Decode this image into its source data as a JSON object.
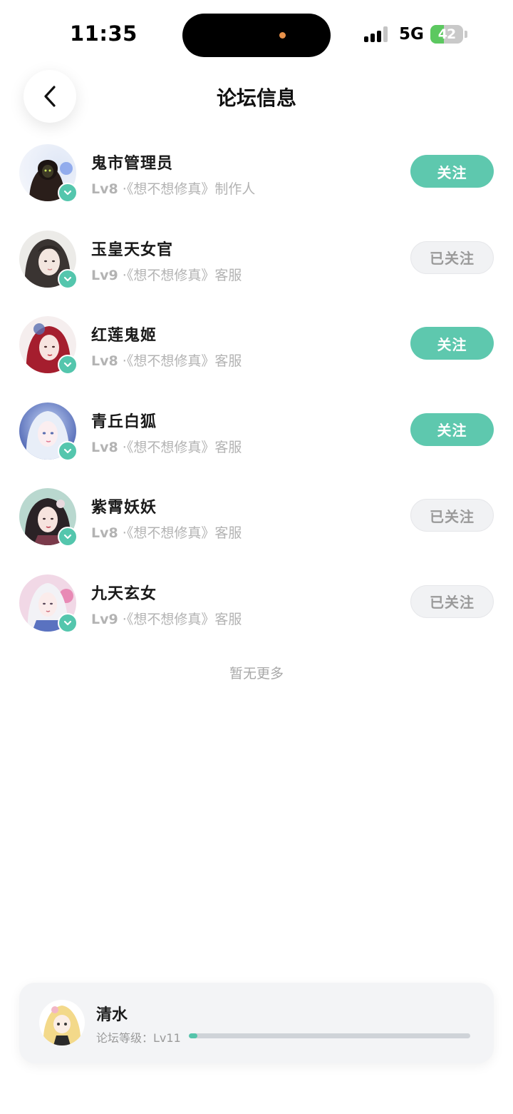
{
  "status_bar": {
    "time": "11:35",
    "network": "5G",
    "battery_level": "42",
    "battery_fraction": 0.42
  },
  "header": {
    "title": "论坛信息",
    "back_icon": "chevron-left-icon"
  },
  "members": [
    {
      "name": "鬼市管理员",
      "level": "Lv8",
      "separator": "·",
      "role": "《想不想修真》制作人",
      "button": "关注",
      "followed": false
    },
    {
      "name": "玉皇天女官",
      "level": "Lv9",
      "separator": "·",
      "role": "《想不想修真》客服",
      "button": "已关注",
      "followed": true
    },
    {
      "name": "红莲鬼姬",
      "level": "Lv8",
      "separator": "·",
      "role": "《想不想修真》客服",
      "button": "关注",
      "followed": false
    },
    {
      "name": "青丘白狐",
      "level": "Lv8",
      "separator": "·",
      "role": "《想不想修真》客服",
      "button": "关注",
      "followed": false
    },
    {
      "name": "紫霄妖妖",
      "level": "Lv8",
      "separator": "·",
      "role": "《想不想修真》客服",
      "button": "已关注",
      "followed": true
    },
    {
      "name": "九天玄女",
      "level": "Lv9",
      "separator": "·",
      "role": "《想不想修真》客服",
      "button": "已关注",
      "followed": true
    }
  ],
  "list_end_text": "暂无更多",
  "current_user": {
    "name": "清水",
    "level_label": "论坛等级：Lv11",
    "level_progress": 0.03
  },
  "colors": {
    "accent": "#5ec8ae",
    "followed_bg": "#f1f2f4",
    "followed_text": "#9a9a9a",
    "verified_badge": "#54c6ad"
  }
}
